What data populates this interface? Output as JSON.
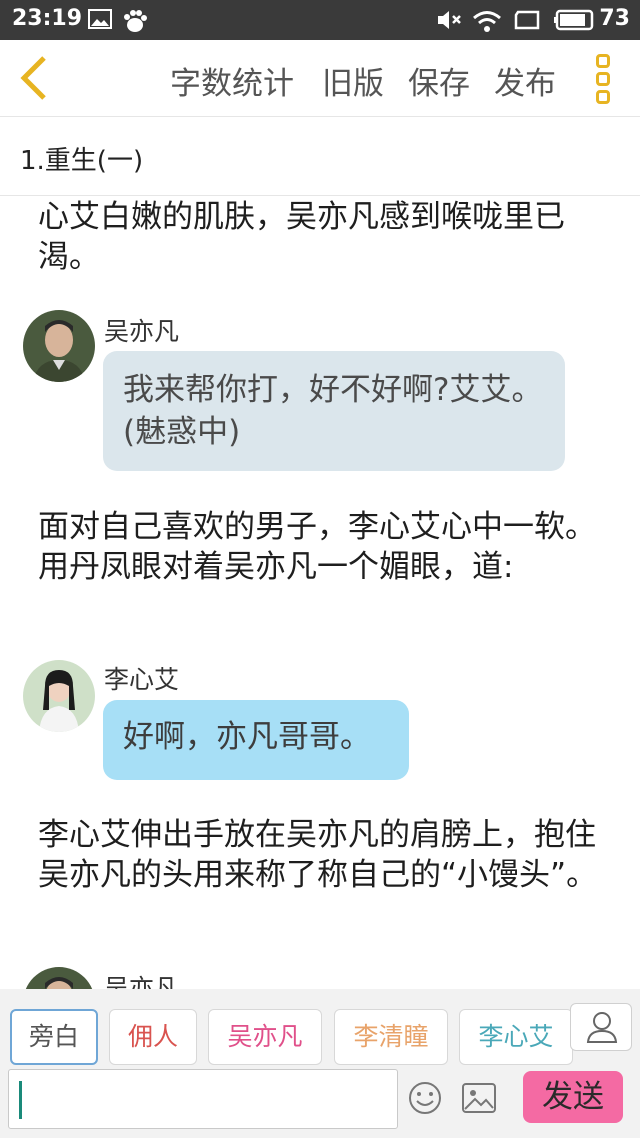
{
  "status_bar": {
    "time": "23:19",
    "battery": "73",
    "icons": [
      "image-icon",
      "baidu-paw-icon",
      "mute-icon",
      "wifi-icon",
      "window-icon",
      "battery-icon"
    ]
  },
  "toolbar": {
    "back_icon": "chevron-left-icon",
    "word_count_label": "字数统计",
    "old_version_label": "旧版",
    "save_label": "保存",
    "publish_label": "发布",
    "more_icon": "more-vertical-icon",
    "accent_color": "#e7b422"
  },
  "chapter": {
    "title": "1.重生(一)"
  },
  "story": {
    "para1": "心艾白嫩的肌肤，吴亦凡感到喉咙里已渴。",
    "msg1": {
      "speaker": "吴亦凡",
      "text": "我来帮你打，好不好啊?艾艾。(魅惑中)"
    },
    "para2": "面对自己喜欢的男子，李心艾心中一软。用丹凤眼对着吴亦凡一个媚眼，道:",
    "msg2": {
      "speaker": "李心艾",
      "text": "好啊，亦凡哥哥。"
    },
    "para3": "李心艾伸出手放在吴亦凡的肩膀上，抱住吴亦凡的头用来称了称自己的“小馒头”。",
    "msg3": {
      "speaker": "吴亦凡"
    }
  },
  "characters": [
    {
      "label": "旁白",
      "color": "#555555",
      "selected": true
    },
    {
      "label": "佣人",
      "color": "#d9534f"
    },
    {
      "label": "吴亦凡",
      "color": "#e0508a"
    },
    {
      "label": "李清瞳",
      "color": "#e8a36a"
    },
    {
      "label": "李心艾",
      "color": "#4aa8b8"
    }
  ],
  "input": {
    "placeholder": "",
    "emoji_icon": "emoji-icon",
    "image_icon": "image-icon",
    "send_label": "发送",
    "send_color": "#f46aa3"
  }
}
